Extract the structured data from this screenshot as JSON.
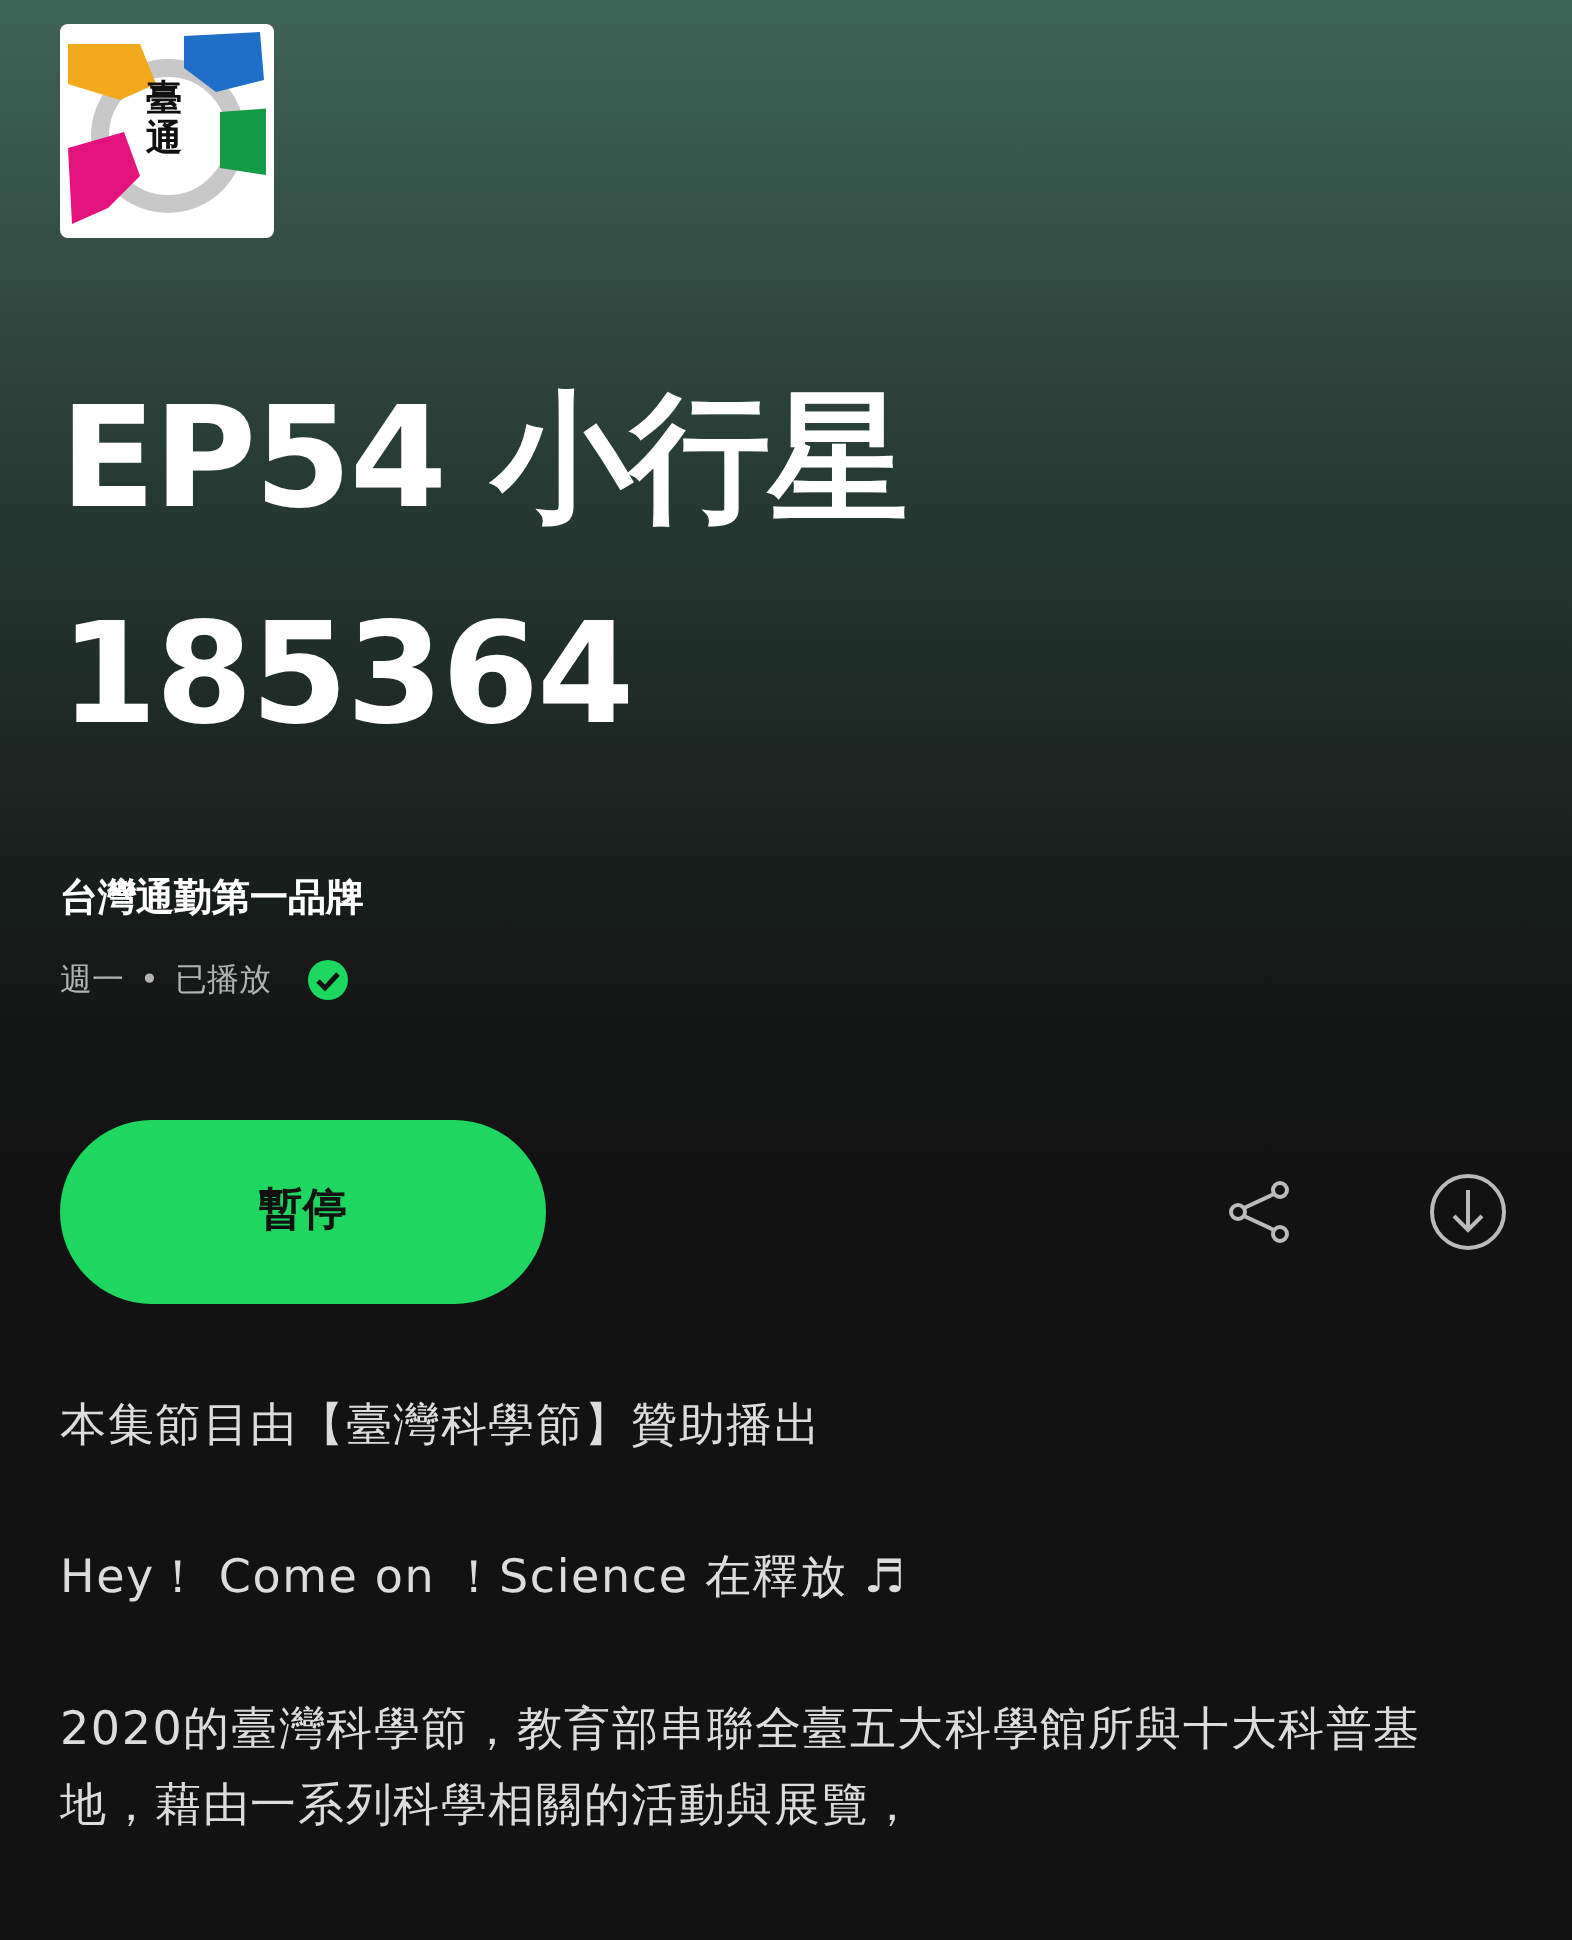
{
  "podcast": {
    "logo_text": "臺通"
  },
  "episode": {
    "title": "EP54 小行星 185364",
    "show": "台灣通勤第一品牌",
    "day": "週一",
    "separator": "•",
    "status": "已播放",
    "played": true
  },
  "actions": {
    "play_button": "暫停"
  },
  "description": [
    "本集節目由【臺灣科學節】贊助播出",
    "Hey！ Come on ！Science 在釋放 ♬",
    "2020的臺灣科學節，教育部串聯全臺五大科學館所與十大科普基地，藉由一系列科學相關的活動與展覽，"
  ]
}
